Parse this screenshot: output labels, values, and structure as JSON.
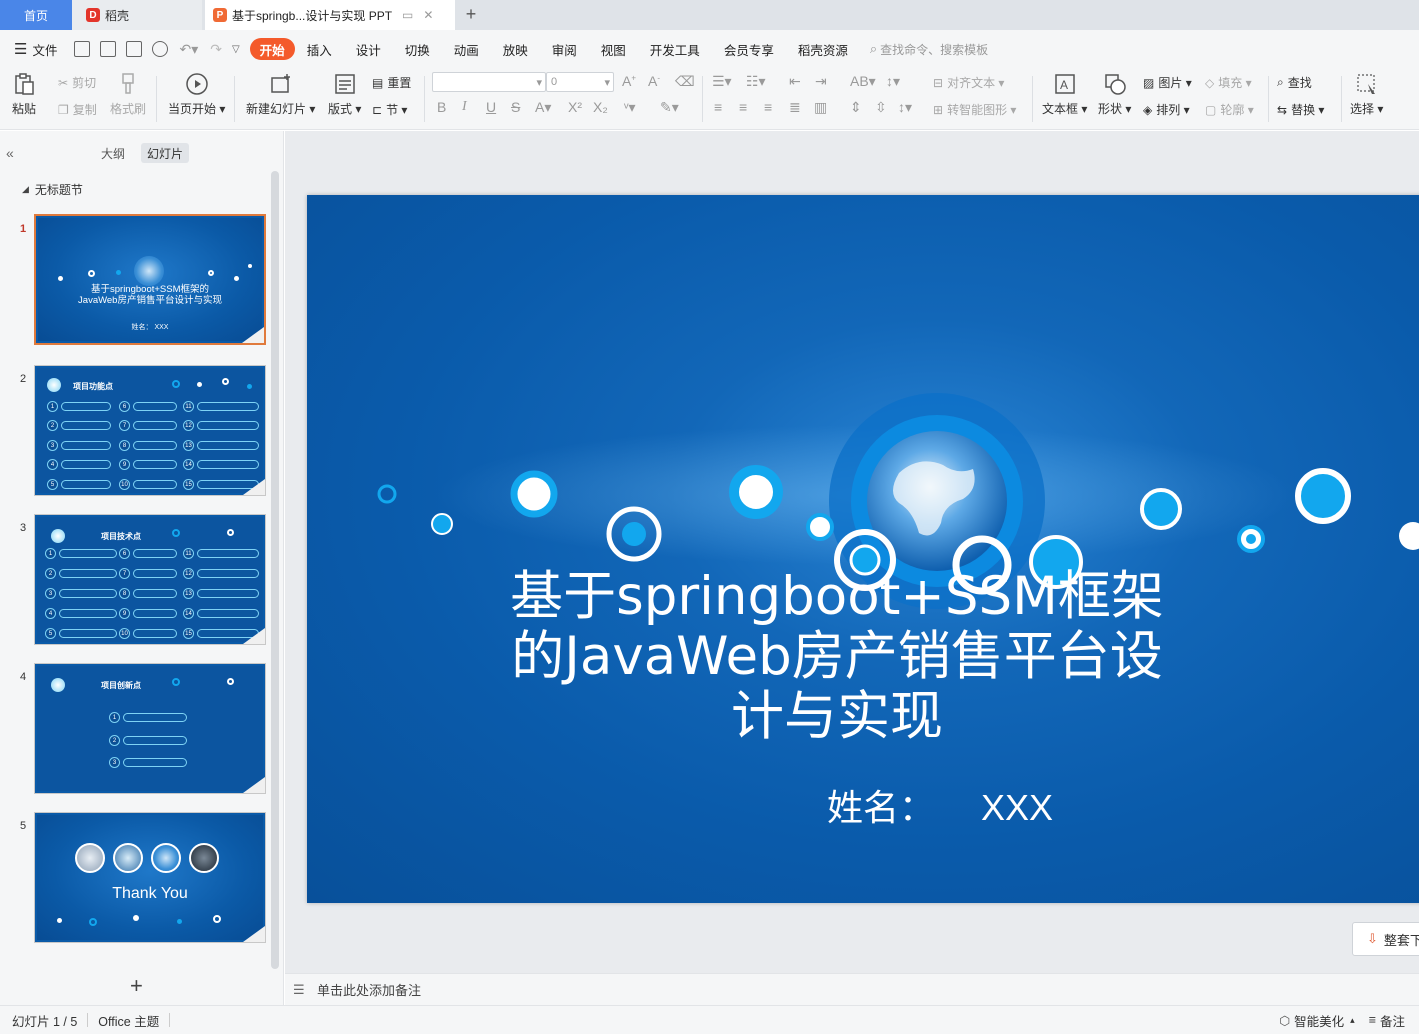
{
  "tabs": {
    "home": "首页",
    "daoke": "稻壳",
    "document": "基于springb...设计与实现 PPT"
  },
  "menu": {
    "file": "文件",
    "items": [
      "开始",
      "插入",
      "设计",
      "切换",
      "动画",
      "放映",
      "审阅",
      "视图",
      "开发工具",
      "会员专享",
      "稻壳资源"
    ],
    "search": "查找命令、搜索模板"
  },
  "ribbon": {
    "paste": "粘贴",
    "cut": "剪切",
    "copy": "复制",
    "format_painter": "格式刷",
    "from_current": "当页开始",
    "new_slide": "新建幻灯片",
    "layout": "版式",
    "reset": "重置",
    "section": "节",
    "font_size": "0",
    "align_text": "对齐文本",
    "smart_art": "转智能图形",
    "text_box": "文本框",
    "shape": "形状",
    "picture": "图片",
    "arrange": "排列",
    "fill": "填充",
    "outline": "轮廓",
    "find": "查找",
    "replace": "替换",
    "select": "选择"
  },
  "left_panel": {
    "outline_tab": "大纲",
    "slides_tab": "幻灯片",
    "section_name": "无标题节",
    "thumbnails": [
      {
        "num": "1",
        "title": "基于springboot+SSM框架的JavaWeb房产销售平台设计与实现",
        "subtitle": "姓名：   XXX"
      },
      {
        "num": "2",
        "title": "项目功能点"
      },
      {
        "num": "3",
        "title": "项目技术点"
      },
      {
        "num": "4",
        "title": "项目创新点"
      },
      {
        "num": "5",
        "title": "Thank You"
      }
    ]
  },
  "slide": {
    "title": "基于springboot+SSM框架的JavaWeb房产销售平台设计与实现",
    "name_label": "姓名：",
    "name_value": "XXX"
  },
  "editor": {
    "whole_set_button": "整套下载",
    "notes_placeholder": "单击此处添加备注"
  },
  "status": {
    "slide_info": "幻灯片 1 / 5",
    "theme": "Office 主题",
    "smart_beautify": "智能美化",
    "notes": "备注"
  },
  "colors": {
    "accent": "#f45a2b",
    "home_tab": "#4a86e8",
    "slide_bg": "#0a5bab",
    "circle_accent": "#12a7ee"
  }
}
